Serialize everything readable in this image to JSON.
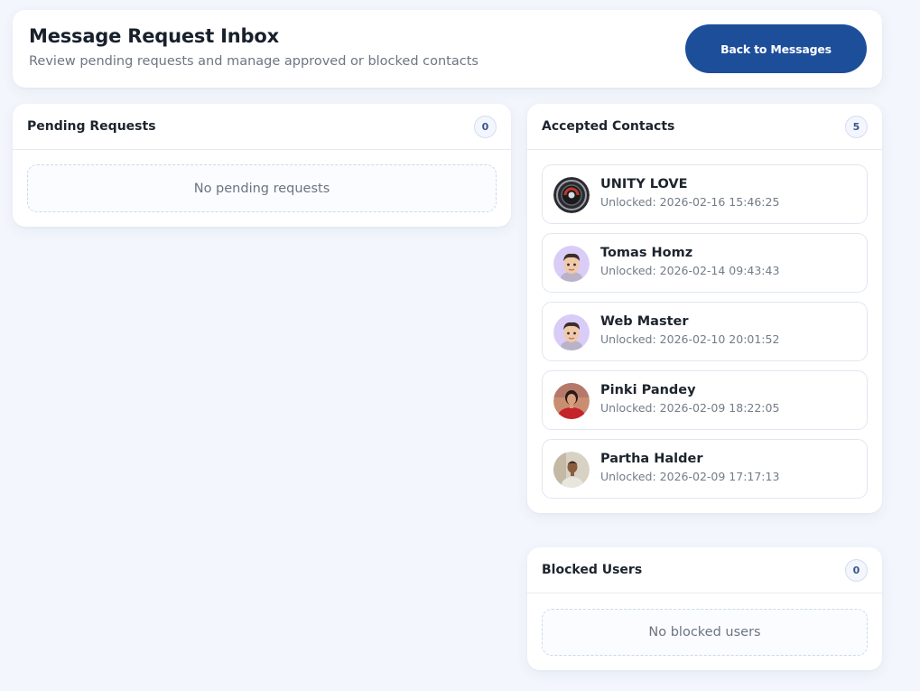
{
  "header": {
    "title": "Message Request Inbox",
    "subtitle": "Review pending requests and manage approved or blocked contacts",
    "back_button_label": "Back to Messages"
  },
  "pending": {
    "title": "Pending Requests",
    "count": "0",
    "empty_text": "No pending requests"
  },
  "accepted": {
    "title": "Accepted Contacts",
    "count": "5",
    "contacts": [
      {
        "name": "UNITY LOVE",
        "unlocked": "Unlocked: 2026-02-16 15:46:25",
        "avatar": "dark-emblem-avatar"
      },
      {
        "name": "Tomas Homz",
        "unlocked": "Unlocked: 2026-02-14 09:43:43",
        "avatar": "cartoon-boy-avatar"
      },
      {
        "name": "Web Master",
        "unlocked": "Unlocked: 2026-02-10 20:01:52",
        "avatar": "cartoon-boy-avatar"
      },
      {
        "name": "Pinki Pandey",
        "unlocked": "Unlocked: 2026-02-09 18:22:05",
        "avatar": "woman-red-dress-photo"
      },
      {
        "name": "Partha Halder",
        "unlocked": "Unlocked: 2026-02-09 17:17:13",
        "avatar": "man-photo"
      }
    ]
  },
  "blocked": {
    "title": "Blocked Users",
    "count": "0",
    "empty_text": "No blocked users"
  },
  "colors": {
    "accent": "#1d4e9a",
    "background": "#f3f6fc",
    "badge_text": "#3a5688"
  }
}
